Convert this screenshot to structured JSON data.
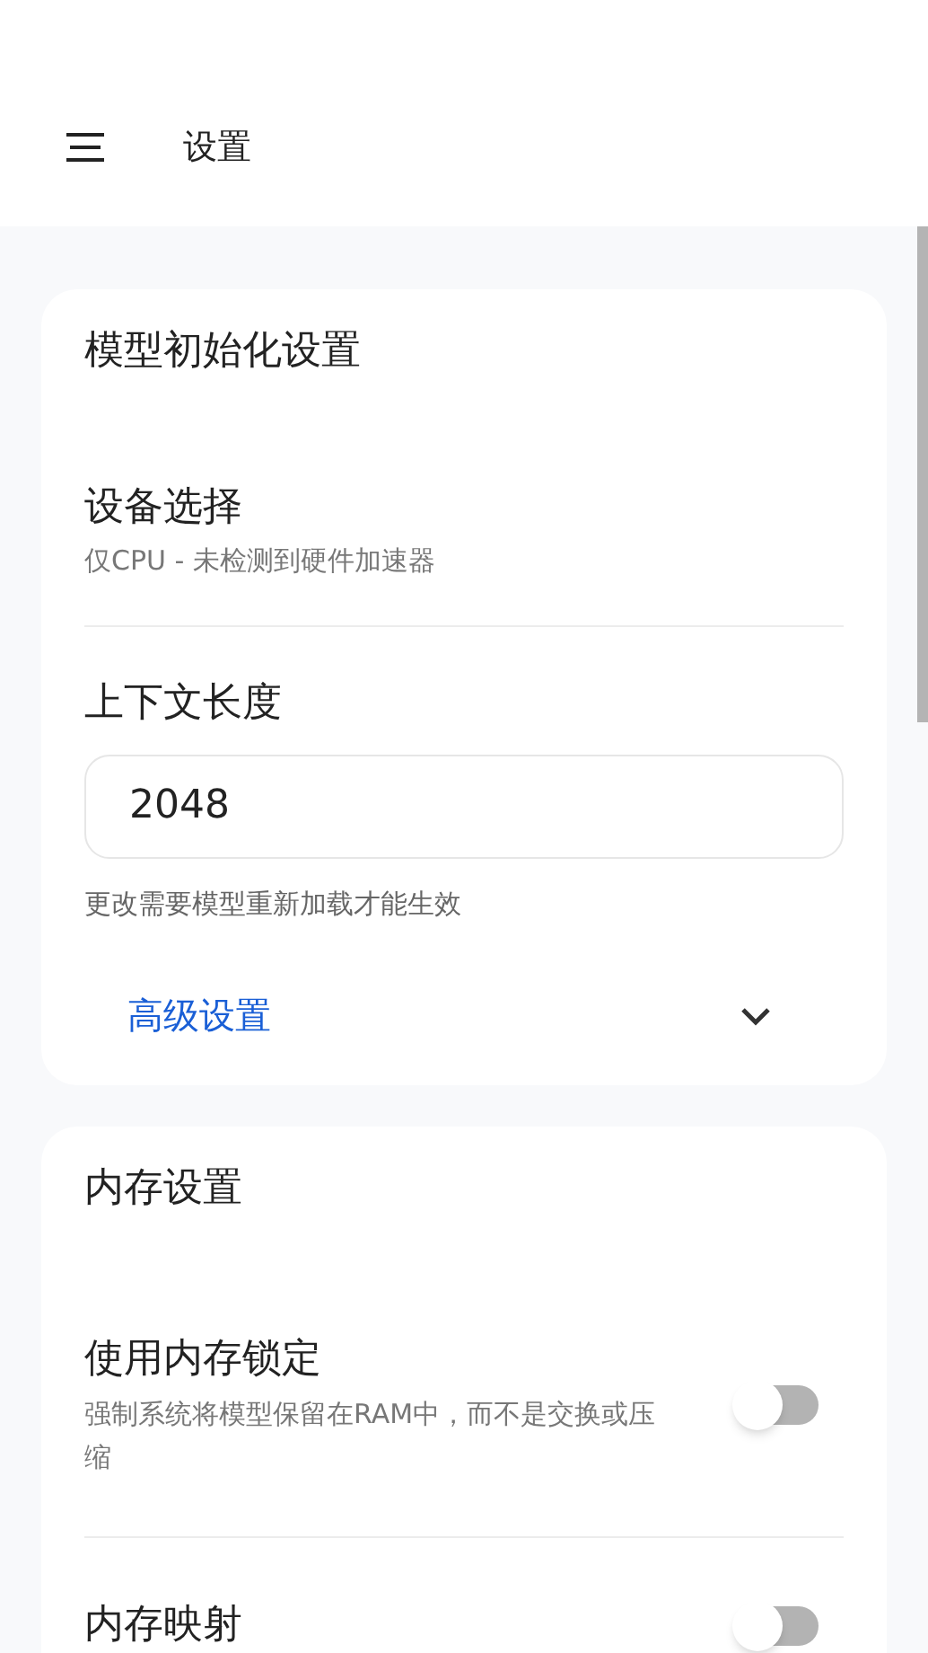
{
  "header": {
    "title": "设置"
  },
  "sections": [
    {
      "title": "模型初始化设置",
      "items": [
        {
          "kind": "info",
          "title": "设备选择",
          "subtitle": "仅CPU - 未检测到硬件加速器"
        },
        {
          "kind": "input",
          "title": "上下文长度",
          "value": "2048",
          "helper": "更改需要模型重新加载才能生效"
        },
        {
          "kind": "expander",
          "title": "高级设置",
          "expanded": false
        }
      ]
    },
    {
      "title": "内存设置",
      "items": [
        {
          "kind": "toggle",
          "title": "使用内存锁定",
          "subtitle": "强制系统将模型保留在RAM中，而不是交换或压缩",
          "on": false
        },
        {
          "kind": "toggle",
          "title": "内存映射",
          "on": false
        }
      ]
    }
  ]
}
